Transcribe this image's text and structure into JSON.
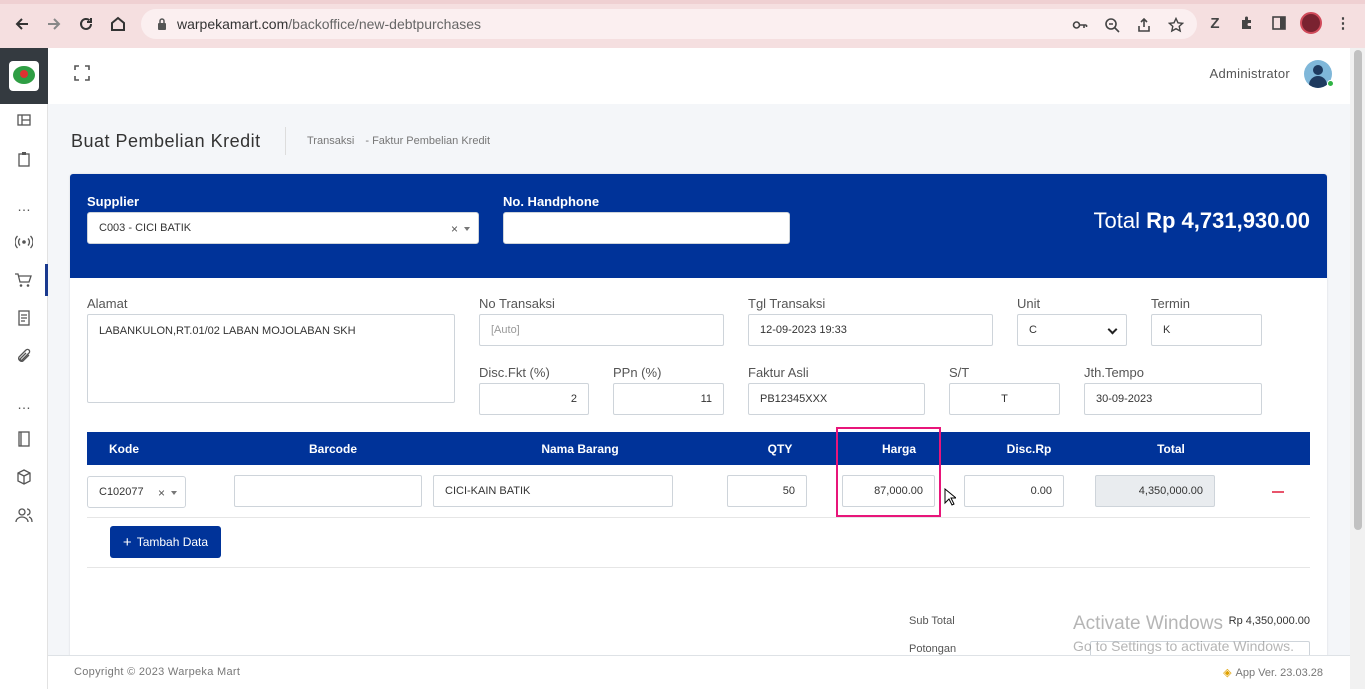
{
  "browser": {
    "url_host": "warpekamart.com",
    "url_path": "/backoffice/new-debtpurchases"
  },
  "topbar": {
    "user_name": "Administrator"
  },
  "page": {
    "title": "Buat Pembelian Kredit",
    "breadcrumb": [
      "Transaksi",
      "-  Faktur Pembelian Kredit"
    ]
  },
  "header": {
    "supplier_label": "Supplier",
    "supplier_value": "C003 - CICI BATIK",
    "phone_label": "No. Handphone",
    "phone_value": "",
    "total_prefix": "Total ",
    "total_value": "Rp 4,731,930.00"
  },
  "form": {
    "alamat_label": "Alamat",
    "alamat_value": "LABANKULON,RT.01/02 LABAN MOJOLABAN SKH",
    "no_transaksi_label": "No Transaksi",
    "no_transaksi_placeholder": "[Auto]",
    "tgl_label": "Tgl Transaksi",
    "tgl_value": "12-09-2023 19:33",
    "unit_label": "Unit",
    "unit_value": "C",
    "termin_label": "Termin",
    "termin_value": "K",
    "disc_label": "Disc.Fkt (%)",
    "disc_value": "2",
    "ppn_label": "PPn (%)",
    "ppn_value": "11",
    "faktur_label": "Faktur Asli",
    "faktur_value": "PB12345XXX",
    "st_label": "S/T",
    "st_value": "T",
    "jth_label": "Jth.Tempo",
    "jth_value": "30-09-2023"
  },
  "table": {
    "headers": [
      "Kode",
      "Barcode",
      "Nama Barang",
      "QTY",
      "Harga",
      "Disc.Rp",
      "Total"
    ],
    "row": {
      "kode": "C102077",
      "barcode": "",
      "nama": "CICI-KAIN BATIK",
      "qty": "50",
      "harga": "87,000.00",
      "disc": "0.00",
      "total": "4,350,000.00"
    },
    "add_label": "Tambah Data"
  },
  "summary": {
    "subtotal_label": "Sub Total",
    "subtotal_value": "Rp 4,350,000.00",
    "potongan_label": "Potongan"
  },
  "watermark": {
    "line1": "Activate Windows",
    "line2": "Go to Settings to activate Windows."
  },
  "footer": {
    "copyright": "Copyright © 2023 Warpeka Mart",
    "version": "App Ver. 23.03.28"
  },
  "colors": {
    "primary": "#003399",
    "highlight": "#e8157a",
    "danger": "#e8546b"
  }
}
